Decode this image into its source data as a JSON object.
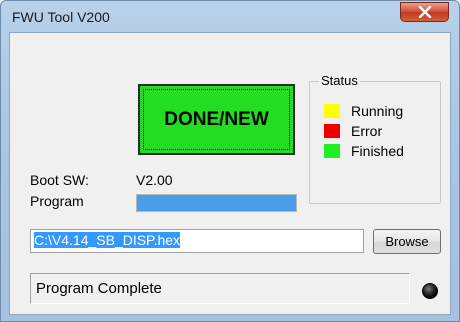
{
  "window": {
    "title": "FWU Tool V200"
  },
  "icons": {
    "close": "close-icon",
    "led": "led-indicator"
  },
  "main_button": {
    "label": "DONE/NEW",
    "color": "#22dd22"
  },
  "status": {
    "legend": "Status",
    "items": [
      {
        "label": "Running",
        "color": "#ffff00"
      },
      {
        "label": "Error",
        "color": "#ee0000"
      },
      {
        "label": "Finished",
        "color": "#22ee22"
      }
    ]
  },
  "boot_sw": {
    "label": "Boot SW:",
    "value": "V2.00"
  },
  "program": {
    "label": "Program",
    "progress": 1.0,
    "progress_color": "#4a9de6"
  },
  "file": {
    "path": "C:\\V4.14_SB_DISP.hex",
    "browse_label": "Browse"
  },
  "statusbar": {
    "text": "Program Complete"
  }
}
